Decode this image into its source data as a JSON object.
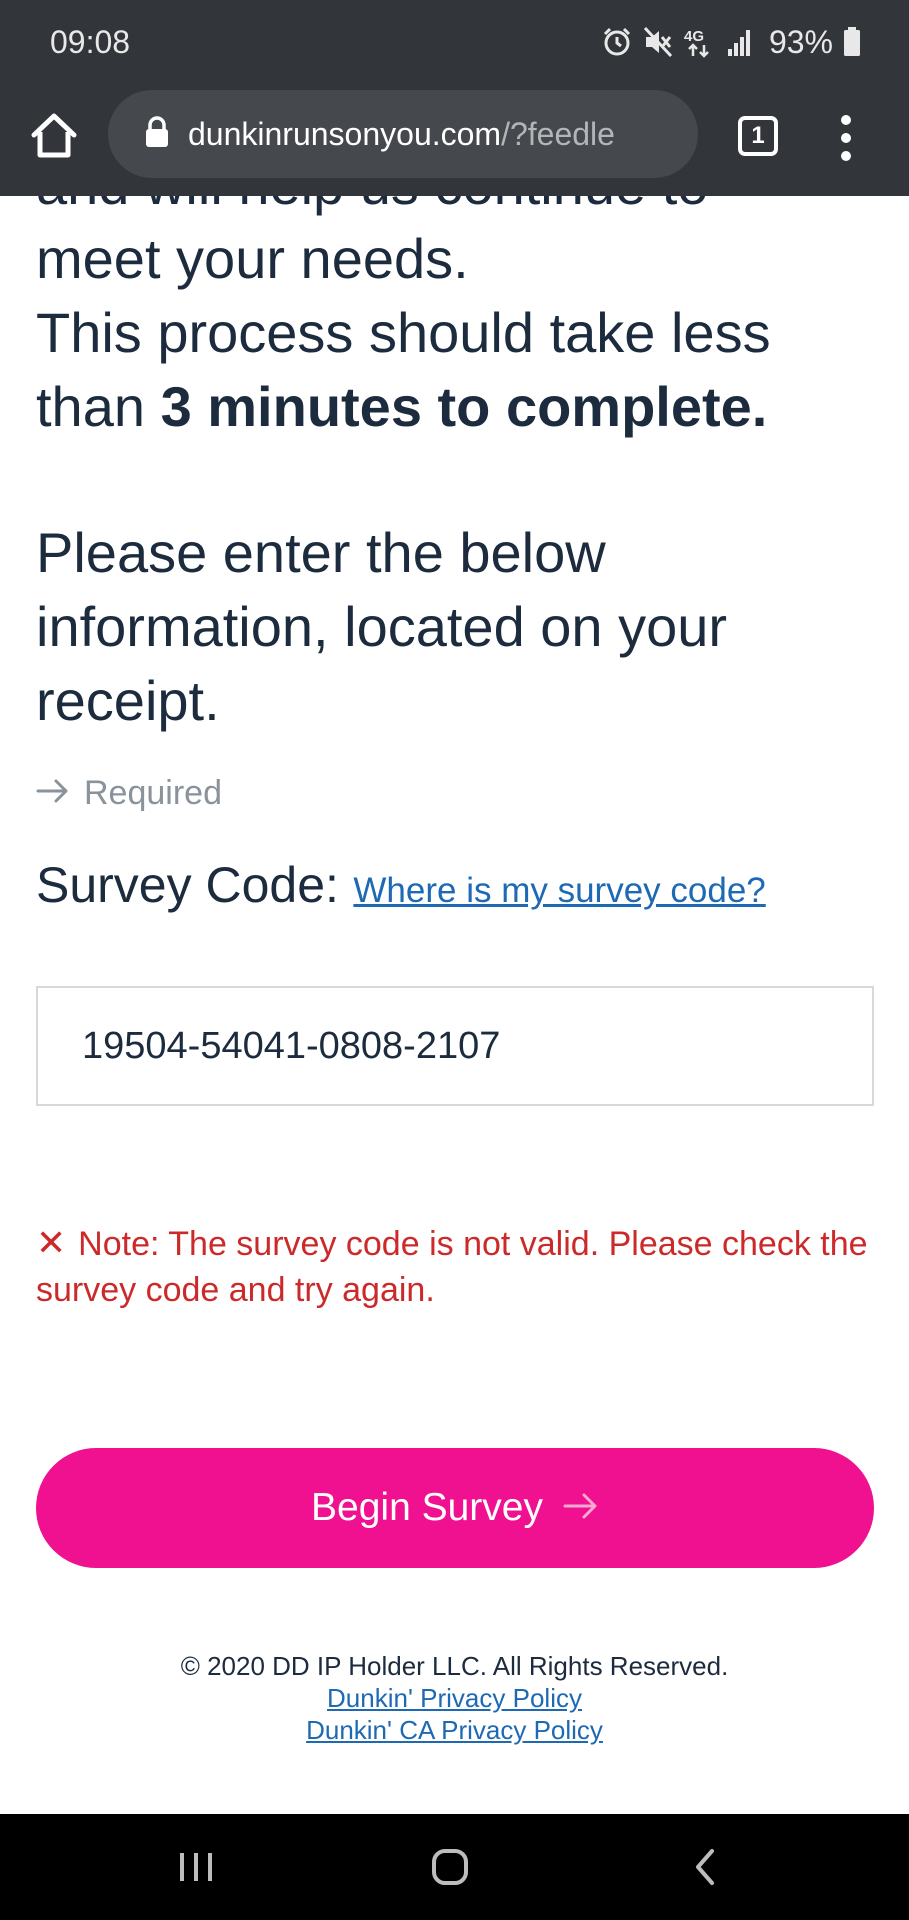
{
  "status_bar": {
    "time": "09:08",
    "battery": "93%",
    "icons": [
      "alarm-icon",
      "mute-icon",
      "4g-icon",
      "signal-icon",
      "battery-icon"
    ]
  },
  "browser": {
    "url_domain": "dunkinrunsonyou.com",
    "url_path": "/?feedle",
    "tab_count": "1"
  },
  "page": {
    "intro_line1": "and will help us continue to",
    "intro_line2": "meet your needs.",
    "intro_line3": "This process should take less",
    "intro_line4_prefix": "than ",
    "intro_line4_bold": "3 minutes to complete.",
    "instructions": "Please enter the below information, located on your receipt.",
    "required_label": "Required",
    "survey_code_label": "Survey Code:",
    "survey_code_link": "Where is my survey code?",
    "survey_code_value": "19504-54041-0808-2107",
    "error_text": "Note: The survey code is not valid. Please check the survey code and try again.",
    "begin_button": "Begin Survey"
  },
  "footer": {
    "copyright": "© 2020 DD IP Holder LLC. All Rights Reserved.",
    "privacy_link": "Dunkin' Privacy Policy",
    "ca_privacy_link": "Dunkin' CA Privacy Policy"
  },
  "colors": {
    "accent": "#ef1190",
    "link": "#1d69b4",
    "error": "#cc2a2a",
    "text": "#1c2b3d"
  }
}
